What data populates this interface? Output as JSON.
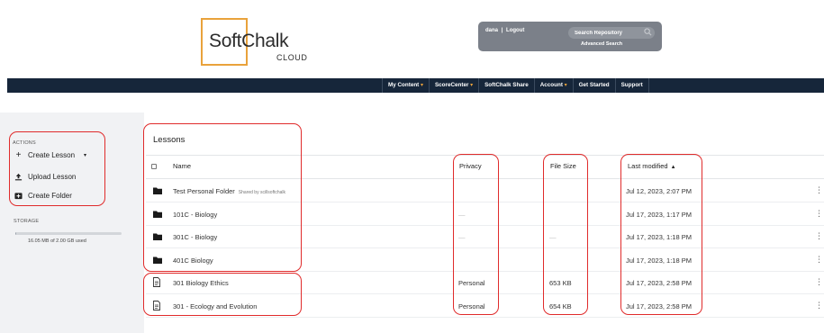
{
  "brand": {
    "name": "SoftChalk",
    "sub": "CLOUD",
    "accent": "#e9a23b"
  },
  "user": {
    "name": "dana",
    "separator": "|",
    "logout": "Logout"
  },
  "search": {
    "placeholder": "Search Repository",
    "advanced": "Advanced Search"
  },
  "nav": [
    {
      "label": "My Content",
      "caret": true
    },
    {
      "label": "ScoreCenter",
      "caret": true
    },
    {
      "label": "SoftChalk Share",
      "caret": false
    },
    {
      "label": "Account",
      "caret": true
    },
    {
      "label": "Get Started",
      "caret": false
    },
    {
      "label": "Support",
      "caret": false
    }
  ],
  "sidebar": {
    "actions_label": "ACTIONS",
    "create_lesson": "Create Lesson",
    "upload_lesson": "Upload Lesson",
    "create_folder": "Create Folder",
    "storage_label": "STORAGE",
    "storage_text": "16.05 MB of 2.00 GB used",
    "storage_used_fraction": 0.008
  },
  "main": {
    "title": "Lessons",
    "columns": {
      "name": "Name",
      "privacy": "Privacy",
      "size": "File Size",
      "modified": "Last modified"
    },
    "rows": [
      {
        "type": "folder",
        "name": "Test Personal Folder",
        "shared": "Shared by scillsoftchalk",
        "privacy": "",
        "size": "",
        "modified": "Jul 12, 2023, 2:07 PM"
      },
      {
        "type": "folder",
        "name": "101C - Biology",
        "shared": "",
        "privacy": "—",
        "size": "",
        "modified": "Jul 17, 2023, 1:17 PM"
      },
      {
        "type": "folder",
        "name": "301C - Biology",
        "shared": "",
        "privacy": "—",
        "size": "—",
        "modified": "Jul 17, 2023, 1:18 PM"
      },
      {
        "type": "folder",
        "name": "401C Biology",
        "shared": "",
        "privacy": "",
        "size": "",
        "modified": "Jul 17, 2023, 1:18 PM"
      },
      {
        "type": "file",
        "name": "301 Biology Ethics",
        "shared": "",
        "privacy": "Personal",
        "size": "653 KB",
        "modified": "Jul 17, 2023, 2:58 PM"
      },
      {
        "type": "file",
        "name": "301 - Ecology and Evolution",
        "shared": "",
        "privacy": "Personal",
        "size": "654 KB",
        "modified": "Jul 17, 2023, 2:58 PM"
      }
    ]
  },
  "colors": {
    "navbar": "#16263a",
    "userbox": "#7b8089",
    "sidebar": "#f1f2f4",
    "annotation": "#e02b2b"
  }
}
